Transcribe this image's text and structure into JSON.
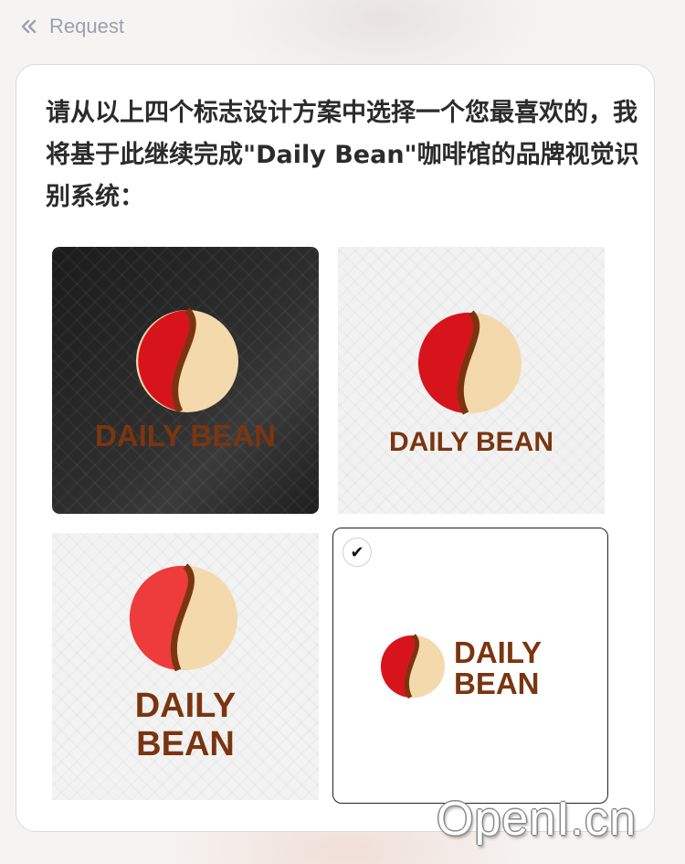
{
  "header": {
    "title": "Request",
    "icon": "collapse-left-icon"
  },
  "message": {
    "text": "请从以上四个标志设计方案中选择一个您最喜欢的，我将基于此继续完成\"Daily Bean\"咖啡馆的品牌视觉识别系统："
  },
  "options": [
    {
      "line1": "DAILY BEAN",
      "selected": false
    },
    {
      "line1": "DAILY BEAN",
      "selected": false
    },
    {
      "line1": "DAILY",
      "line2": "BEAN",
      "selected": false
    },
    {
      "line1": "DAILY",
      "line2": "BEAN",
      "selected": true
    }
  ],
  "selection": {
    "check_icon": "checkmark-icon",
    "check_glyph": "✔"
  },
  "watermark": {
    "text": "OpenI.cn"
  },
  "colors": {
    "red": "#d7141c",
    "cream": "#f4d9ac",
    "brown": "#7a3510",
    "dark_bg": "#222222"
  }
}
